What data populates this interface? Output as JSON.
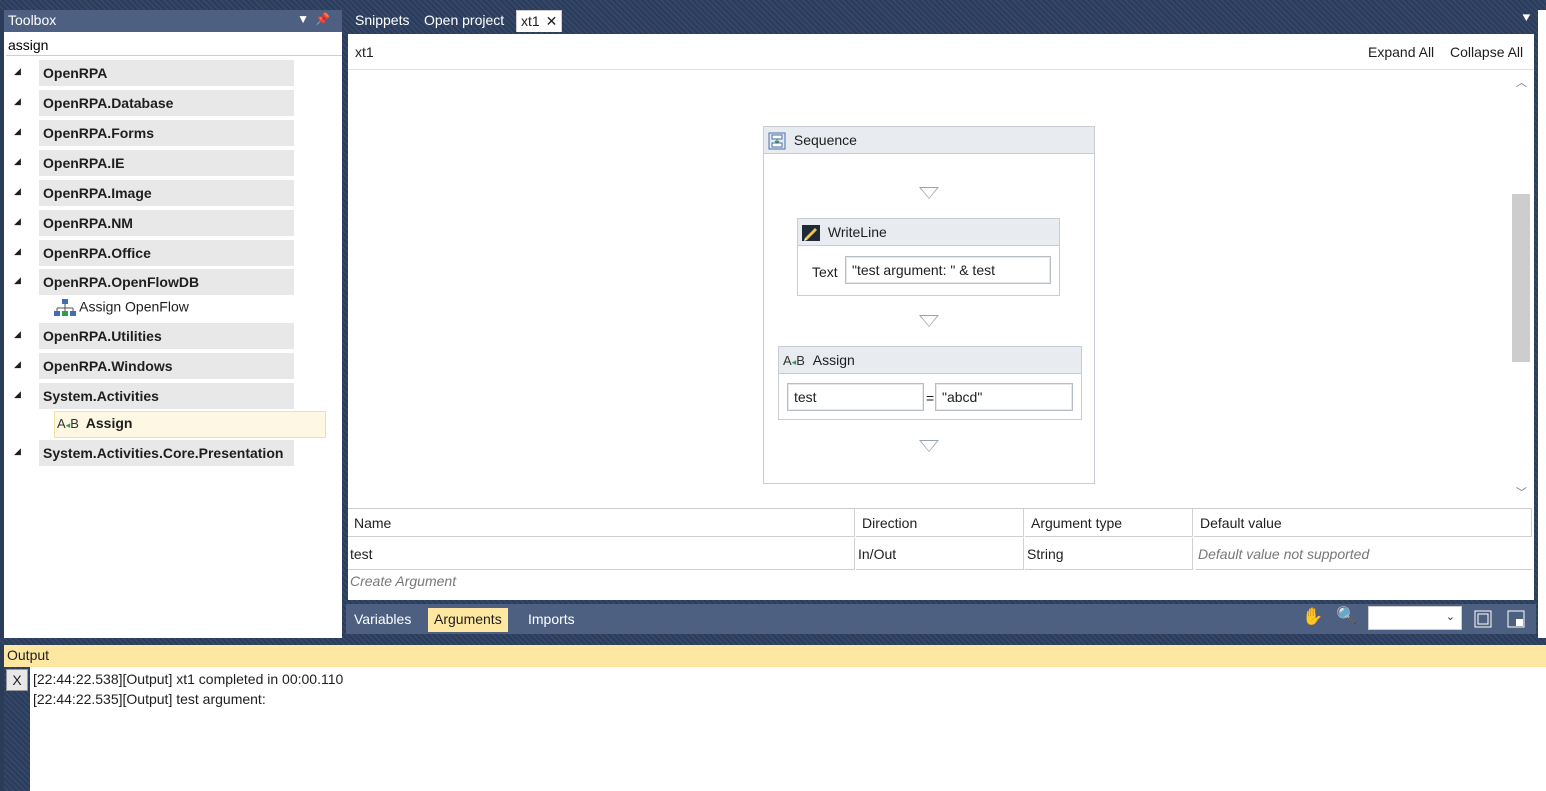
{
  "toolbox": {
    "title": "Toolbox",
    "search_value": "assign",
    "categories": [
      {
        "label": "OpenRPA"
      },
      {
        "label": "OpenRPA.Database"
      },
      {
        "label": "OpenRPA.Forms"
      },
      {
        "label": "OpenRPA.IE"
      },
      {
        "label": "OpenRPA.Image"
      },
      {
        "label": "OpenRPA.NM"
      },
      {
        "label": "OpenRPA.Office"
      },
      {
        "label": "OpenRPA.OpenFlowDB"
      },
      {
        "label": "OpenRPA.Utilities"
      },
      {
        "label": "OpenRPA.Windows"
      },
      {
        "label": "System.Activities"
      },
      {
        "label": "System.Activities.Core.Presentation"
      }
    ],
    "items": {
      "assign_openflow": "Assign OpenFlow",
      "assign": "Assign"
    }
  },
  "tabs": [
    {
      "label": "Snippets"
    },
    {
      "label": "Open project"
    },
    {
      "label": "xt1"
    }
  ],
  "designer": {
    "breadcrumb": "xt1",
    "expand_all": "Expand All",
    "collapse_all": "Collapse All",
    "sequence_title": "Sequence",
    "writeline_title": "WriteLine",
    "writeline_text_label": "Text",
    "writeline_text_value": "\"test argument: \" & test",
    "assign_title": "Assign",
    "assign_to": "test",
    "assign_eq": "=",
    "assign_value": "\"abcd\""
  },
  "arguments": {
    "headers": [
      "Name",
      "Direction",
      "Argument type",
      "Default value"
    ],
    "rows": [
      {
        "name": "test",
        "direction": "In/Out",
        "type": "String",
        "default": "Default value not supported"
      }
    ],
    "create_label": "Create Argument"
  },
  "bottom_tabs": {
    "variables": "Variables",
    "arguments": "Arguments",
    "imports": "Imports"
  },
  "output": {
    "title": "Output",
    "clear_label": "X",
    "lines": [
      "[22:44:22.538][Output] xt1 completed in 00:00.110",
      "[22:44:22.535][Output] test argument:"
    ]
  },
  "colors": {
    "panel_header": "#4d6082",
    "active_tab": "#fde7a1",
    "background": "#2e3f5c"
  }
}
